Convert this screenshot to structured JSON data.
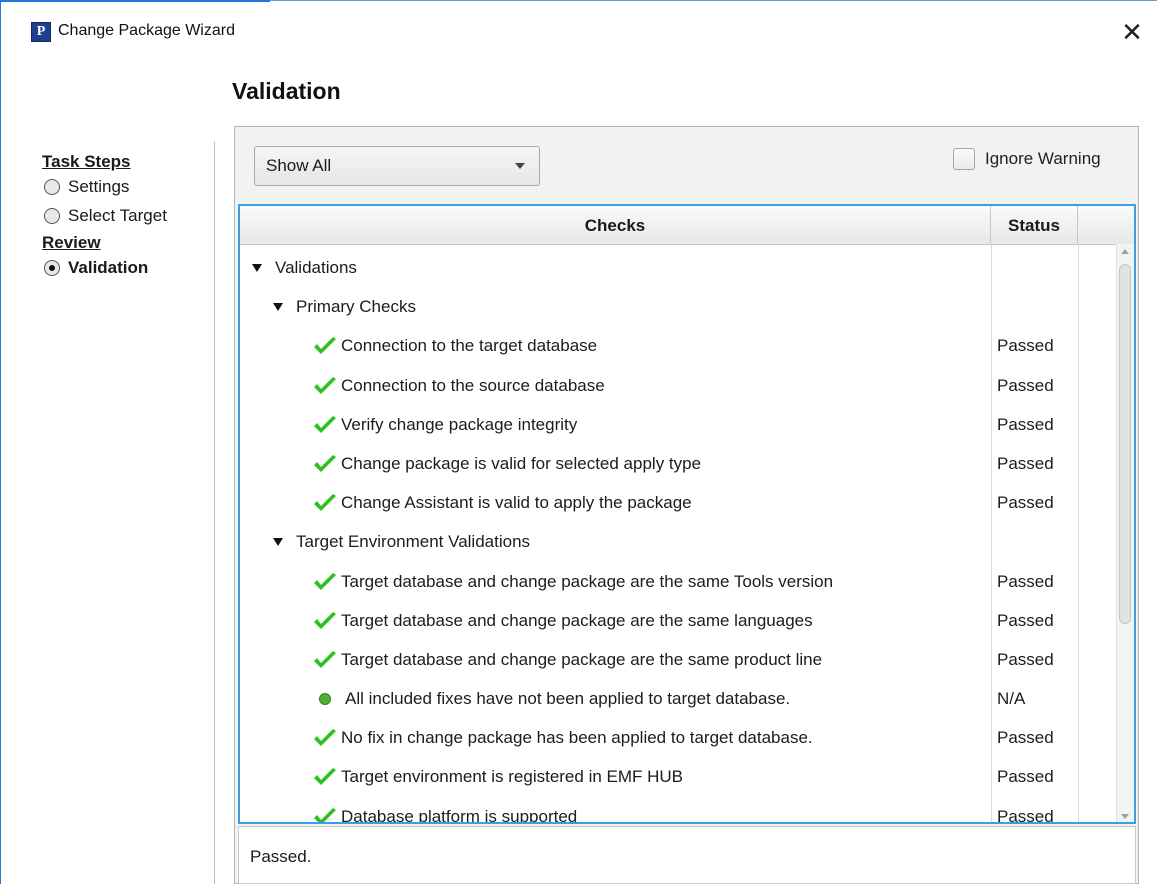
{
  "window": {
    "icon_letter": "P",
    "title": "Change Package Wizard",
    "close_glyph": "✕"
  },
  "page": {
    "heading": "Validation"
  },
  "steps": {
    "task_header": "Task Steps",
    "task_items": [
      {
        "label": "Settings"
      },
      {
        "label": "Select Target"
      }
    ],
    "review_header": "Review",
    "review_items": [
      {
        "label": "Validation"
      }
    ]
  },
  "toolbar": {
    "filter_value": "Show All",
    "ignore_warning_label": "Ignore Warning"
  },
  "table": {
    "columns": [
      "Checks",
      "Status"
    ],
    "rows": [
      {
        "level": 0,
        "type": "group",
        "text": "Validations",
        "status": ""
      },
      {
        "level": 1,
        "type": "group",
        "text": "Primary Checks",
        "status": ""
      },
      {
        "level": 2,
        "type": "check",
        "text": "Connection to the target database",
        "status": "Passed"
      },
      {
        "level": 2,
        "type": "check",
        "text": "Connection to the source database",
        "status": "Passed"
      },
      {
        "level": 2,
        "type": "check",
        "text": "Verify change package integrity",
        "status": "Passed"
      },
      {
        "level": 2,
        "type": "check",
        "text": "Change package is valid for selected apply type",
        "status": "Passed"
      },
      {
        "level": 2,
        "type": "check",
        "text": "Change Assistant is valid to apply the package",
        "status": "Passed"
      },
      {
        "level": 1,
        "type": "group",
        "text": "Target Environment Validations",
        "status": ""
      },
      {
        "level": 2,
        "type": "check",
        "text": "Target database and change package are the same Tools version",
        "status": "Passed"
      },
      {
        "level": 2,
        "type": "check",
        "text": "Target database and change package are the same languages",
        "status": "Passed"
      },
      {
        "level": 2,
        "type": "check",
        "text": "Target database and change package are the same product line",
        "status": "Passed"
      },
      {
        "level": 2,
        "type": "dot",
        "text": "All included fixes have not been applied to target database.",
        "status": "N/A"
      },
      {
        "level": 2,
        "type": "check",
        "text": "No fix in change package has been applied to target database.",
        "status": "Passed"
      },
      {
        "level": 2,
        "type": "check",
        "text": "Target environment is registered in EMF HUB",
        "status": "Passed"
      },
      {
        "level": 2,
        "type": "check",
        "text": "Database platform is supported",
        "status": "Passed"
      }
    ]
  },
  "message": {
    "text": "Passed."
  },
  "colors": {
    "accent": "#3c9de2",
    "check_green": "#2bc21f",
    "na_dot": "#4fb233"
  }
}
